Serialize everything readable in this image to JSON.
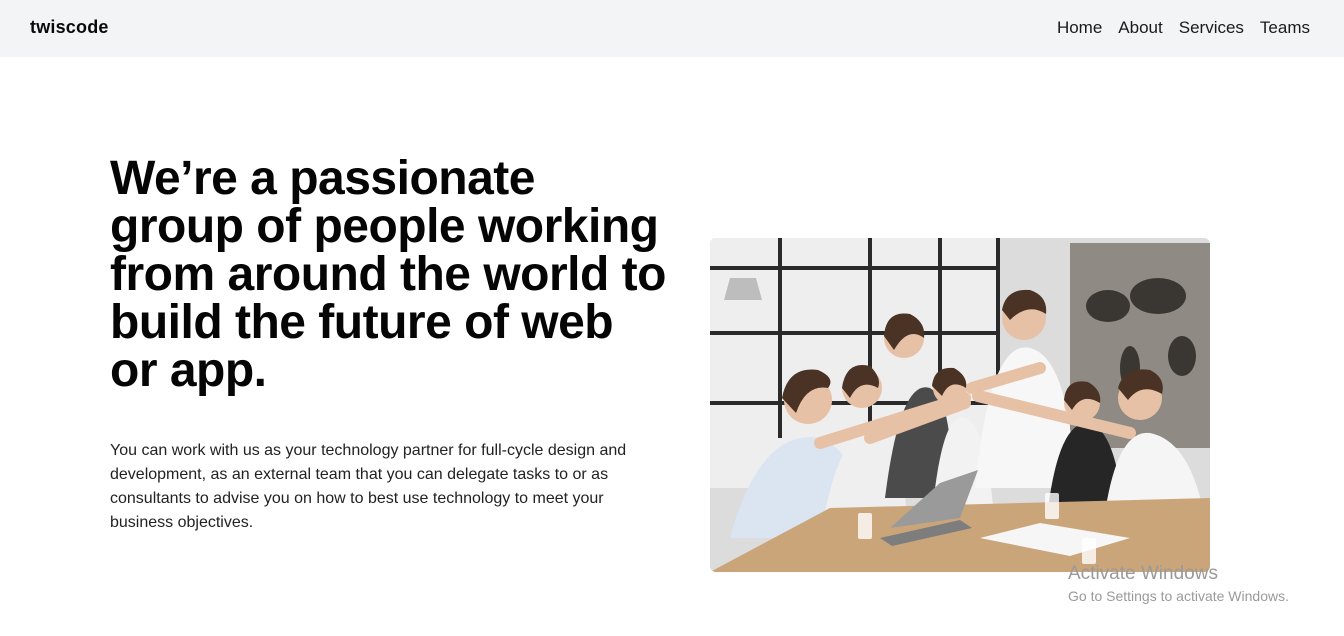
{
  "navbar": {
    "brand": "twiscode",
    "links": [
      "Home",
      "About",
      "Services",
      "Teams"
    ]
  },
  "hero": {
    "headline": "We’re a passionate group of people working from around the world to build the future of web or app.",
    "description": "You can work with us as your technology partner for full-cycle design and development, as an external team that you can delegate tasks to or as consultants to advise you on how to best use technology to meet your business objectives."
  },
  "watermark": {
    "title": "Activate Windows",
    "subtitle": "Go to Settings to activate Windows."
  },
  "colors": {
    "navbar_bg": "#f3f4f6",
    "text": "#050505",
    "watermark": "#9a9a9a"
  }
}
